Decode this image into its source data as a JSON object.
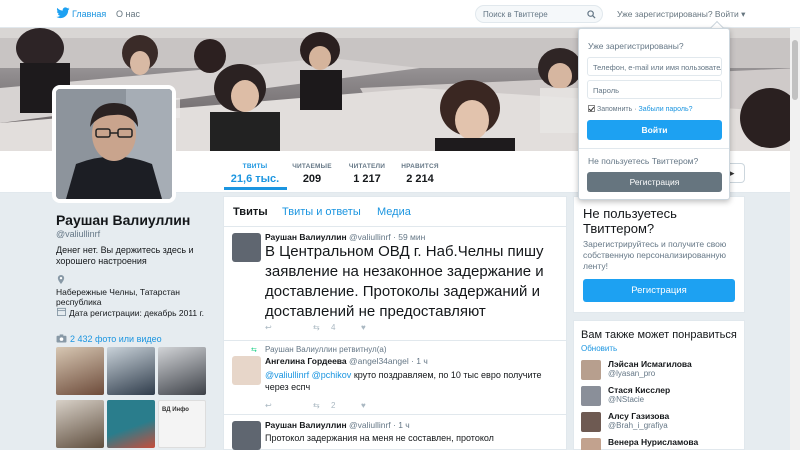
{
  "nav": {
    "home_label": "Главная",
    "about_label": "О нас",
    "search_placeholder": "Поиск в Твиттере",
    "login_prompt": "Уже зарегистрированы? Войти ▾"
  },
  "profile": {
    "name": "Раушан Валиуллин",
    "handle": "@valiullinrf",
    "bio": "Денег нет. Вы держитесь здесь и хорошего настроения",
    "location": "Набережные Челны, Татарстан республика",
    "joined": "Дата регистрации: декабрь 2011 г.",
    "photos_link": "2 432 фото или видео"
  },
  "stats": [
    {
      "label": "ТВИТЫ",
      "value": "21,6 тыс.",
      "active": true
    },
    {
      "label": "ЧИТАЕМЫЕ",
      "value": "209"
    },
    {
      "label": "ЧИТАТЕЛИ",
      "value": "1 217"
    },
    {
      "label": "НРАВИТСЯ",
      "value": "2 214"
    }
  ],
  "timeline": {
    "tabs": [
      "Твиты",
      "Твиты и ответы",
      "Медиа"
    ],
    "tweets": [
      {
        "name": "Раушан Валиуллин",
        "meta": "@valiullinrf · 59 мин",
        "text": "В Центральном ОВД г. Наб.Челны пишу заявление на незаконное задержание и доставление. Протоколы задержаний и доставлений не предоставляют",
        "retweets": "4",
        "likes": ""
      },
      {
        "retweet_note": "Раушан Валиуллин ретвитнул(а)",
        "name": "Ангелина Гордеева",
        "meta": "@angel34angel · 1 ч",
        "mentions": "@valiullinrf @pchikov",
        "text": " круто поздравляем, по 10 тыс евро получите через еспч",
        "retweets": "2",
        "likes": ""
      },
      {
        "name": "Раушан Валиуллин",
        "meta": "@valiullinrf · 1 ч",
        "text": "Протокол задержания на меня  не составлен, протокол"
      }
    ]
  },
  "signup_card": {
    "title": "Не пользуетесь Твиттером?",
    "text": "Зарегистрируйтесь и получите свою собственную персонализированную ленту!",
    "button": "Регистрация"
  },
  "who_to_follow": {
    "title": "Вам также может понравиться",
    "refresh": "Обновить",
    "users": [
      {
        "name": "Лэйсан Исмагилова",
        "handle": "@lyasan_pro"
      },
      {
        "name": "Стася Кисслер",
        "handle": "@NStacie"
      },
      {
        "name": "Алсу Газизова",
        "handle": "@Brah_i_grafiya"
      },
      {
        "name": "Венера Нурисламова",
        "handle": ""
      }
    ]
  },
  "login_dropdown": {
    "title": "Уже зарегистрированы?",
    "login_placeholder": "Телефон, e-mail или имя пользователя",
    "password_placeholder": "Пароль",
    "remember": "Запомнить",
    "separator": " · ",
    "forgot": "Забыли пароль?",
    "login_button": "Войти",
    "not_using": "Не пользуетесь Твиттером?",
    "register_button": "Регистрация"
  },
  "photo_thumbs": [
    {
      "text": "",
      "colors": [
        "#c9b9a6",
        "#6d4b3a"
      ]
    },
    {
      "text": "",
      "colors": [
        "#b8c3cc",
        "#3e4a57"
      ]
    },
    {
      "text": "",
      "colors": [
        "#c7c9cc",
        "#4a4e54"
      ]
    },
    {
      "text": "",
      "colors": [
        "#d5cfc7",
        "#6c5b4a"
      ]
    },
    {
      "text": "",
      "colors": [
        "#2a7d8c",
        "#c84d3b"
      ]
    },
    {
      "text": "ВД Инфо",
      "colors": [
        "#ffffff",
        "#444444"
      ]
    }
  ],
  "colors": {
    "accent": "#1b95e0",
    "button": "#1da1f2",
    "secondary_button": "#66757f"
  }
}
